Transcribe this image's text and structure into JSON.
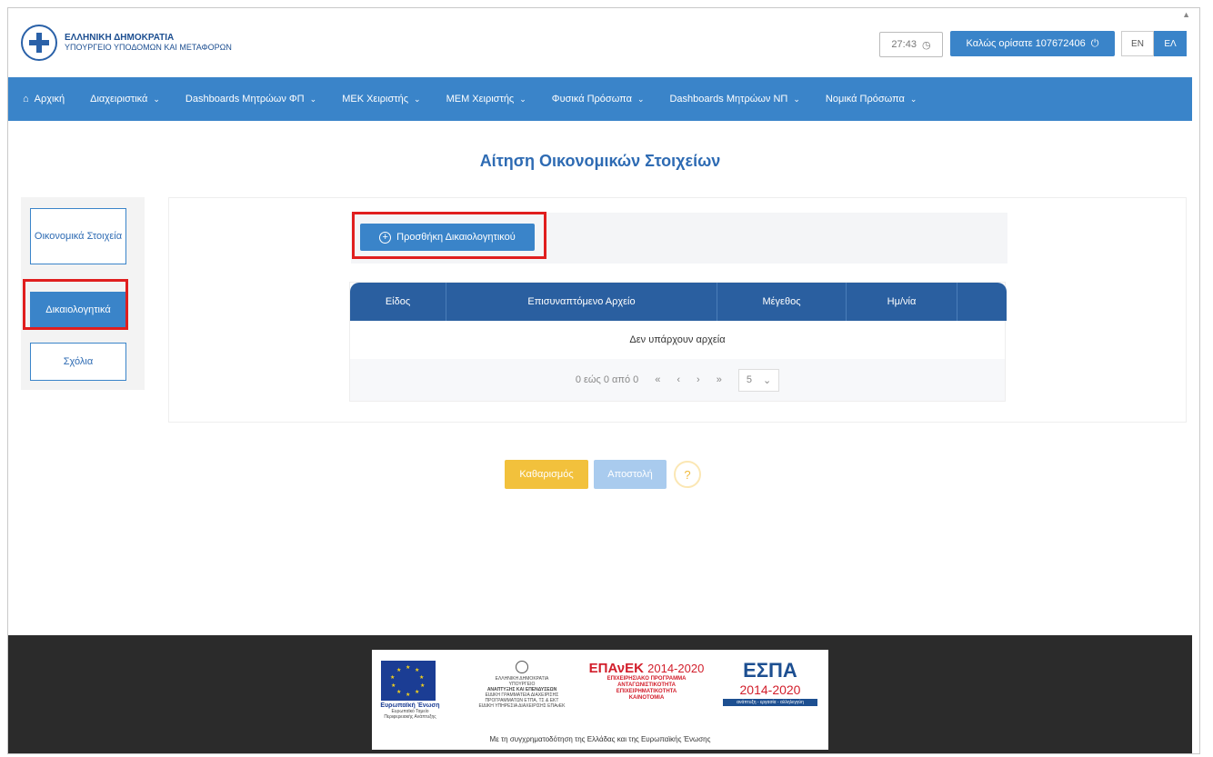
{
  "header": {
    "org_line1": "ΕΛΛΗΝΙΚΗ ΔΗΜΟΚΡΑΤΙΑ",
    "org_line2": "ΥΠΟΥΡΓΕΙΟ ΥΠΟΔΟΜΩΝ ΚΑΙ ΜΕΤΑΦΟΡΩΝ",
    "clock": "27:43",
    "welcome": "Καλώς ορίσατε 107672406",
    "lang_en": "EN",
    "lang_el": "ΕΛ"
  },
  "nav": {
    "items": [
      {
        "label": "Αρχική",
        "icon": "home-icon",
        "dropdown": false
      },
      {
        "label": "Διαχειριστικά",
        "dropdown": true
      },
      {
        "label": "Dashboards Μητρώων ΦΠ",
        "dropdown": true
      },
      {
        "label": "ΜΕΚ Χειριστής",
        "dropdown": true
      },
      {
        "label": "ΜΕΜ Χειριστής",
        "dropdown": true
      },
      {
        "label": "Φυσικά Πρόσωπα",
        "dropdown": true
      },
      {
        "label": "Dashboards Μητρώων ΝΠ",
        "dropdown": true
      },
      {
        "label": "Νομικά Πρόσωπα",
        "dropdown": true
      }
    ]
  },
  "page": {
    "title": "Αίτηση Οικονομικών Στοιχείων"
  },
  "side": {
    "items": [
      {
        "label": "Οικονομικά Στοιχεία",
        "active": false
      },
      {
        "label": "Δικαιολογητικά",
        "active": true
      },
      {
        "label": "Σχόλια",
        "active": false
      }
    ]
  },
  "documents": {
    "add_label": "Προσθήκη Δικαιολογητικού",
    "columns": [
      "Είδος",
      "Επισυναπτόμενο Αρχείο",
      "Μέγεθος",
      "Ημ/νία",
      ""
    ],
    "empty_text": "Δεν υπάρχουν αρχεία",
    "pager": {
      "range": "0 εώς 0 από 0",
      "first": "«",
      "prev": "‹",
      "next": "›",
      "last": "»",
      "page_size": "5"
    }
  },
  "actions": {
    "clear": "Καθαρισμός",
    "send": "Αποστολή",
    "help": "?"
  },
  "footer": {
    "eu_title": "Ευρωπαϊκή Ένωση",
    "eu_sub1": "Ευρωπαϊκό Ταμείο",
    "eu_sub2": "Περιφερειακής Ανάπτυξης",
    "gr_line1": "ΕΛΛΗΝΙΚΗ ΔΗΜΟΚΡΑΤΙΑ",
    "gr_line2": "ΥΠΟΥΡΓΕΙΟ",
    "gr_line3": "ΑΝΑΠΤΥΞΗΣ ΚΑΙ ΕΠΕΝΔΥΣΕΩΝ",
    "gr_line4": "ΕΙΔΙΚΗ ΓΡΑΜΜΑΤΕΙΑ ΔΙΑΧΕΙΡΙΣΗΣ",
    "gr_line5": "ΠΡΟΓΡΑΜΜΑΤΩΝ ΕΤΠΑ, ΤΣ & ΕΚΤ",
    "gr_line6": "ΕΙΔΙΚΗ ΥΠΗΡΕΣΙΑ ΔΙΑΧΕΙΡΙΣΗΣ ΕΠΑνΕΚ",
    "epanek": "ΕΠΑνΕΚ",
    "epanek_years": "2014-2020",
    "epanek_l1": "ΕΠΙΧΕΙΡΗΣΙΑΚΟ ΠΡΟΓΡΑΜΜΑ",
    "epanek_l2": "ΑΝΤΑΓΩΝΙΣΤΙΚΟΤΗΤΑ",
    "epanek_l3": "ΕΠΙΧΕΙΡΗΜΑΤΙΚΟΤΗΤΑ",
    "epanek_l4": "ΚΑΙΝΟΤΟΜΙΑ",
    "espa": "ΕΣΠΑ",
    "espa_years": "2014-2020",
    "espa_tag": "ανάπτυξη - εργασία - αλληλεγγύη",
    "caption": "Με τη συγχρηματοδότηση της Ελλάδας και της Ευρωπαϊκής Ένωσης"
  },
  "colors": {
    "primary": "#3a84c9",
    "table_header": "#2a5fa0",
    "title": "#2e6bb3",
    "clear_button": "#f2c13c",
    "send_button_disabled": "#a9cbee",
    "highlight_box": "#e01e1e",
    "footer_bg": "#2b2b2b"
  }
}
